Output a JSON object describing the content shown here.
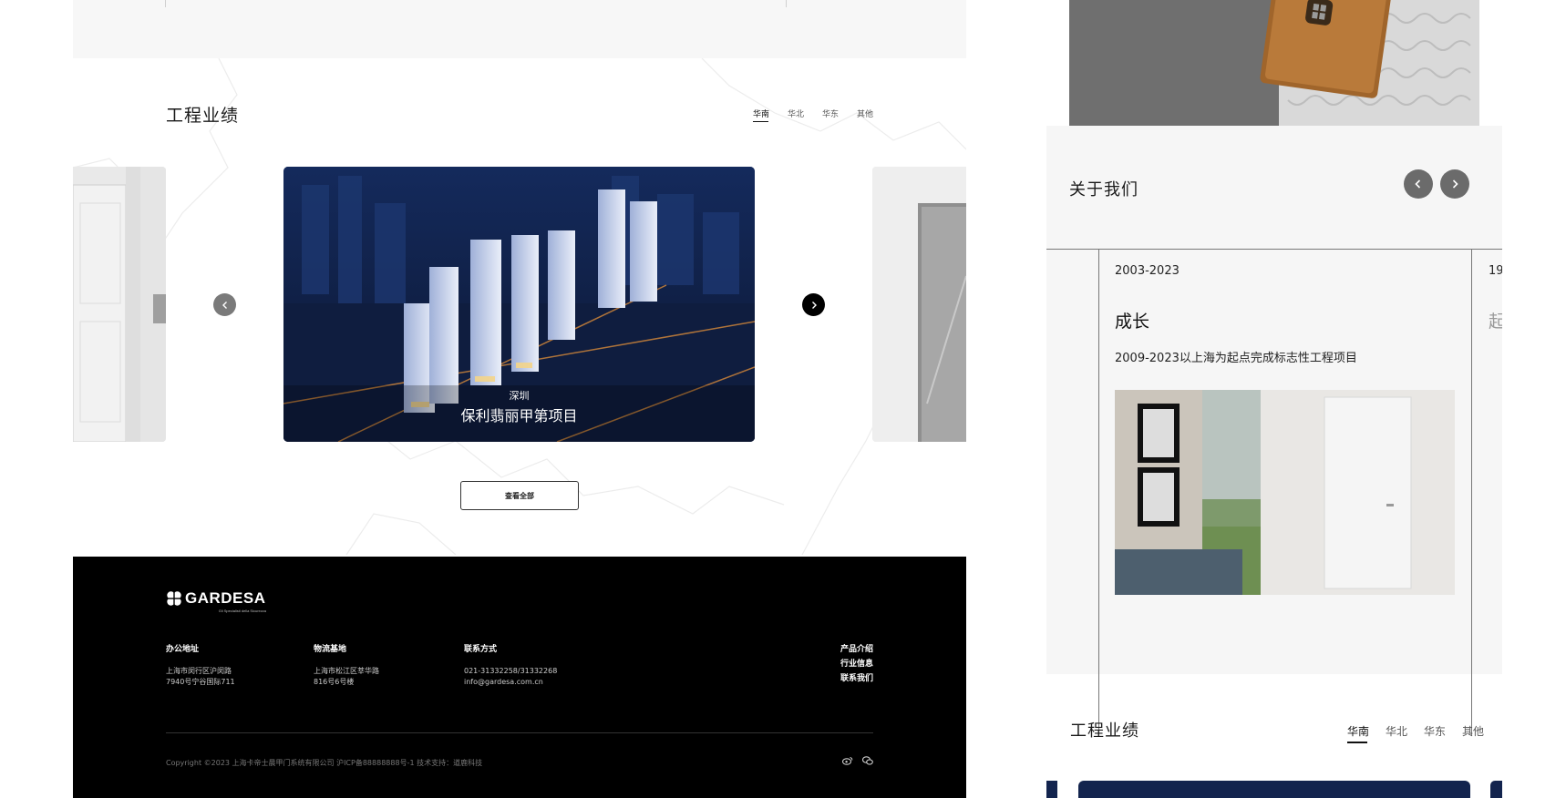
{
  "desktop": {
    "projects": {
      "title": "工程业绩",
      "tabs": [
        "华南",
        "华北",
        "华东",
        "其他"
      ],
      "active_tab": "华南",
      "slide": {
        "city": "深圳",
        "name": "保利翡丽甲第项目"
      },
      "view_all": "查看全部"
    },
    "footer": {
      "logo_text": "GARDESA",
      "logo_tagline": "Gli Specialisti della Sicurezza",
      "office": {
        "title": "办公地址",
        "line1": "上海市闵行区沪闵路",
        "line2": "7940号宁谷国际711"
      },
      "logistics": {
        "title": "物流基地",
        "line1": "上海市松江区莘华路",
        "line2": "816号6号楼"
      },
      "contact": {
        "title": "联系方式",
        "phone": "021-31332258/31332268",
        "email": "info@gardesa.com.cn"
      },
      "links": [
        "产品介绍",
        "行业信息",
        "联系我们"
      ],
      "copyright": "Copyright ©2023 上海卡帝士晨甲门系统有限公司 沪ICP备88888888号-1 技术支持：道鹿科技"
    }
  },
  "mobile": {
    "about": {
      "title": "关于我们",
      "range": "2003-2023",
      "heading": "成长",
      "desc": "2009-2023以上海为起点完成标志性工程项目",
      "peek_range": "19",
      "peek_heading": "起"
    },
    "projects": {
      "title": "工程业绩",
      "tabs": [
        "华南",
        "华北",
        "华东",
        "其他"
      ],
      "active_tab": "华南"
    }
  },
  "icons": {
    "arrow_prev": "chevron-left-icon",
    "arrow_next": "chevron-right-icon",
    "weibo": "weibo-icon",
    "wechat": "wechat-icon",
    "logo_mark": "clover-logo-icon"
  },
  "colors": {
    "footer_bg": "#000000",
    "night_blue": "#13244e",
    "panel_gray": "#f6f6f6",
    "arrow_gray": "#6b6b6b"
  }
}
